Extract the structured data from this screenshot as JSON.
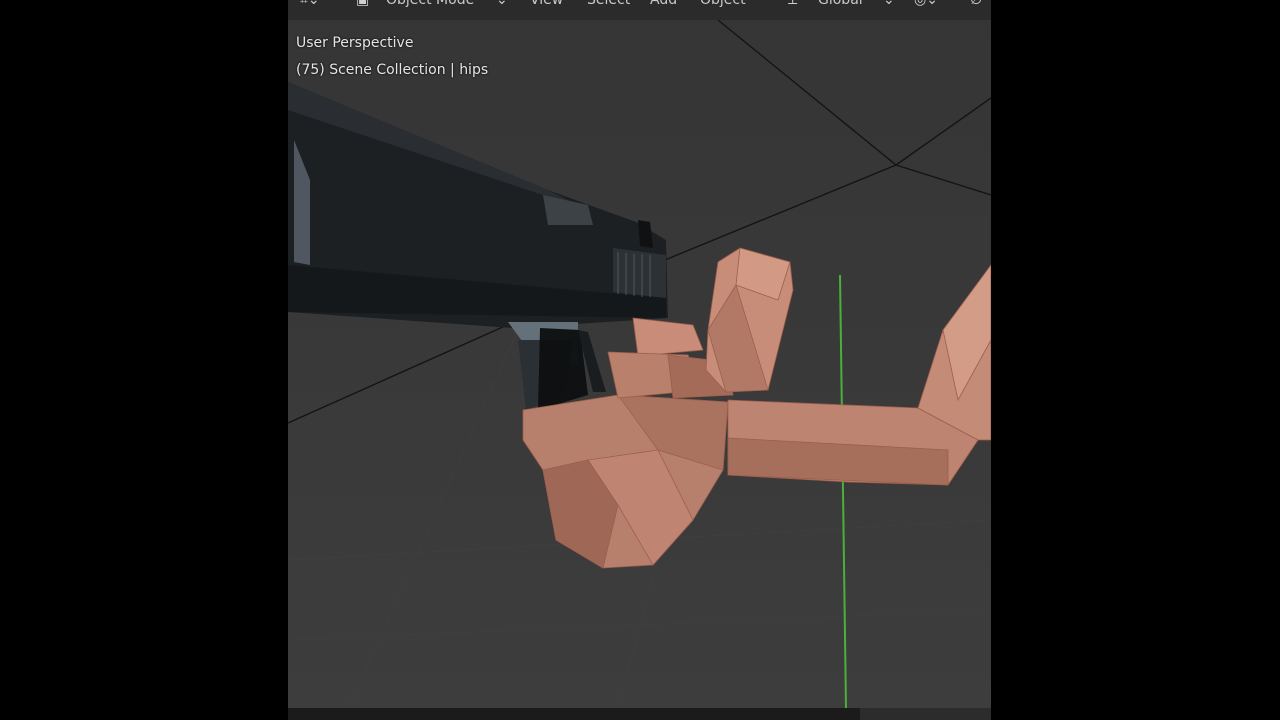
{
  "header": {
    "transform_icon": "transform-grid-icon",
    "mode_icon": "object-cube-icon",
    "mode_label": "Object Mode",
    "menus": [
      "View",
      "Select",
      "Add",
      "Object"
    ],
    "orientation_icon": "transform-orientation-icon",
    "orientation_label": "Global",
    "pivot_icon": "pivot-point-icon",
    "snap_icon": "snap-icon"
  },
  "viewport": {
    "view_name": "User Perspective",
    "collection_info": "(75) Scene Collection | hips"
  },
  "colors": {
    "viewport_bg": "#3a3a3a",
    "skin": "#b97a66",
    "gun": "#1c1f22",
    "y_axis": "#4caf3a",
    "grid_line": "#1a1a1a"
  }
}
